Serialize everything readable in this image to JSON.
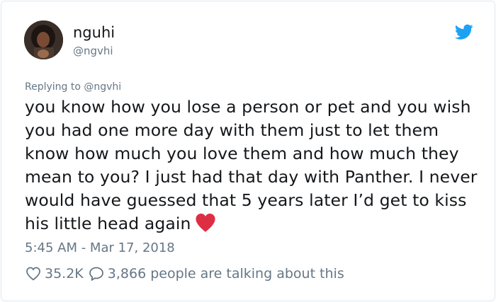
{
  "tweet": {
    "author_name": "nguhi",
    "author_handle": "@ngvhi",
    "replying_prefix": "Replying to",
    "replying_handle": "@ngvhi",
    "text": "you know how you lose a person or pet and you wish you had one more day with them just to let them know how much you love them and how much they mean to you? I just had that day with Panther. I never would have guessed that 5 years later I’d get to kiss his little head again",
    "emoji": "red-heart",
    "timestamp": "5:45 AM - Mar 17, 2018",
    "like_count": "35.2K",
    "talking_text": "3,866 people are talking about this"
  },
  "icons": {
    "brand": "twitter-bird-icon",
    "like": "heart-outline-icon",
    "comment": "speech-bubble-icon"
  },
  "colors": {
    "twitter_blue": "#1da1f2",
    "secondary_text": "#657786",
    "primary_text": "#14171a",
    "emoji_red": "#dd2e44",
    "border": "#e1e8ed"
  }
}
